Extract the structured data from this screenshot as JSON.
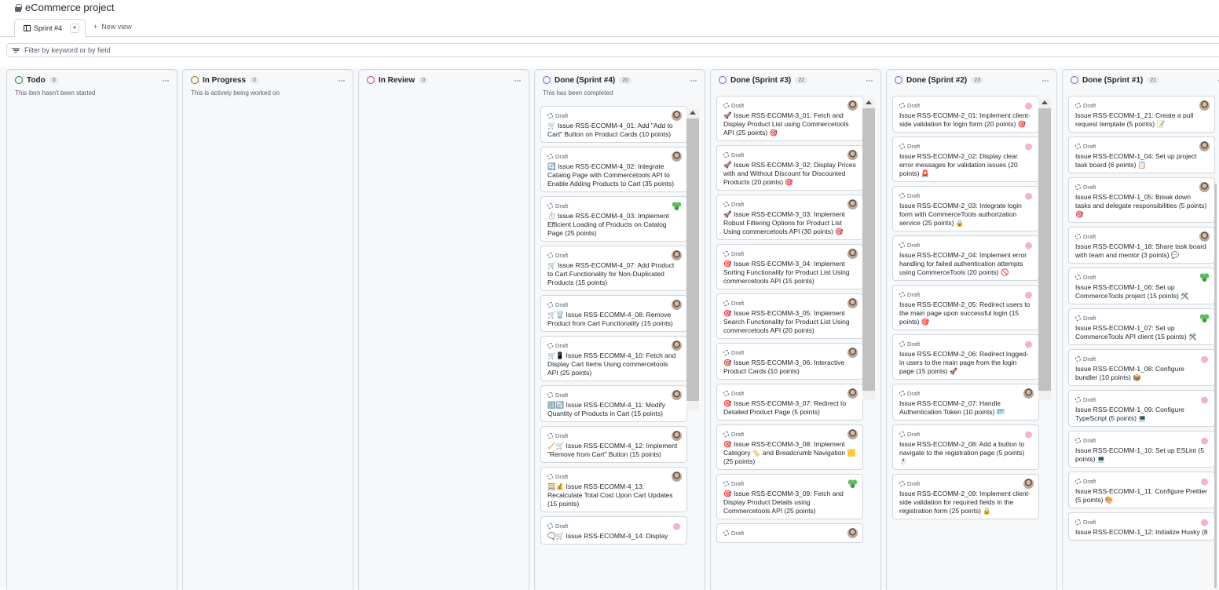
{
  "project": {
    "title": "eCommerce project"
  },
  "tabs": [
    {
      "label": "Sprint #4"
    }
  ],
  "new_view_label": "New view",
  "filter": {
    "placeholder": "Filter by keyword or by field"
  },
  "colors": {
    "todo": "#1a7f37",
    "in_progress": "#9a6700",
    "in_review": "#bf3989",
    "done": "#8250df",
    "border": "#d0d7de"
  },
  "columns": [
    {
      "name": "Todo",
      "count": "0",
      "description": "This item hasn't been started",
      "status": "todo",
      "cards": []
    },
    {
      "name": "In Progress",
      "count": "0",
      "description": "This is actively being worked on",
      "status": "in_progress",
      "cards": []
    },
    {
      "name": "In Review",
      "count": "0",
      "description": "",
      "status": "in_review",
      "cards": []
    },
    {
      "name": "Done (Sprint #4)",
      "count": "20",
      "description": "This has been completed",
      "status": "done",
      "cards": [
        {
          "status": "Draft",
          "avatar": "photo",
          "title": "🛒 Issue RSS-ECOMM-4_01: Add \"Add to Cart\" Button on Product Cards (10 points)"
        },
        {
          "status": "Draft",
          "avatar": "photo",
          "title": "🔄 Issue RSS-ECOMM-4_02: Integrate Catalog Page with Commercetools API to Enable Adding Products to Cart (35 points)"
        },
        {
          "status": "Draft",
          "avatar": "clover",
          "title": "⏱️ Issue RSS-ECOMM-4_03: Implement Efficient Loading of Products on Catalog Page (25 points)"
        },
        {
          "status": "Draft",
          "avatar": "photo",
          "title": "🛒 Issue RSS-ECOMM-4_07: Add Product to Cart Functionality for Non-Duplicated Products (15 points)"
        },
        {
          "status": "Draft",
          "avatar": "photo",
          "title": "🛒🗑️ Issue RSS-ECOMM-4_08: Remove Product from Cart Functionality (15 points)"
        },
        {
          "status": "Draft",
          "avatar": "photo",
          "title": "🛒📱 Issue RSS-ECOMM-4_10: Fetch and Display Cart Items Using commercetools API (25 points)"
        },
        {
          "status": "Draft",
          "avatar": "photo",
          "title": "🔢🔄 Issue RSS-ECOMM-4_11: Modify Quantity of Products in Cart (15 points)"
        },
        {
          "status": "Draft",
          "avatar": "photo",
          "title": "🧹🛒 Issue RSS-ECOMM-4_12: Implement \"Remove from Cart\" Button (15 points)"
        },
        {
          "status": "Draft",
          "avatar": "photo",
          "title": "🧮💰 Issue RSS-ECOMM-4_13: Recalculate Total Cost Upon Cart Updates (15 points)"
        },
        {
          "status": "Draft",
          "avatar": "pig",
          "title": "🗨️🛒 Issue RSS-ECOMM-4_14: Display"
        }
      ]
    },
    {
      "name": "Done (Sprint #3)",
      "count": "22",
      "description": "",
      "status": "done",
      "cards": [
        {
          "status": "Draft",
          "avatar": "photo",
          "title": "🚀 Issue RSS-ECOMM-3_01: Fetch and Display Product List using Commercetools API (25 points) 🎯"
        },
        {
          "status": "Draft",
          "avatar": "photo",
          "title": "🚀 Issue RSS-ECOMM-3_02: Display Prices with and Without Discount for Discounted Products (20 points) 🎯"
        },
        {
          "status": "Draft",
          "avatar": "photo",
          "title": "🚀 Issue RSS-ECOMM-3_03: Implement Robust Filtering Options for Product List Using commercetools API (30 points) 🎯"
        },
        {
          "status": "Draft",
          "avatar": "photo",
          "title": "🎯 Issue RSS-ECOMM-3_04: Implement Sorting Functionality for Product List Using commercetools API (15 points)"
        },
        {
          "status": "Draft",
          "avatar": "photo",
          "title": "🎯 Issue RSS-ECOMM-3_05: Implement Search Functionality for Product List Using commercetools API (20 points)"
        },
        {
          "status": "Draft",
          "avatar": "photo",
          "title": "🎯 Issue RSS-ECOMM-3_06: Interactive Product Cards (10 points)"
        },
        {
          "status": "Draft",
          "avatar": "photo",
          "title": "🎯 Issue RSS-ECOMM-3_07: Redirect to Detailed Product Page (5 points)"
        },
        {
          "status": "Draft",
          "avatar": "photo",
          "title": "🎯 Issue RSS-ECOMM-3_08: Implement Category 🏷️ and Breadcrumb Navigation 🟨 (25 points)"
        },
        {
          "status": "Draft",
          "avatar": "clover",
          "title": "🎯 Issue RSS-ECOMM-3_09: Fetch and Display Product Details using Commercetools API (25 points)"
        },
        {
          "status": "Draft",
          "avatar": "photo",
          "title": ""
        }
      ]
    },
    {
      "name": "Done (Sprint #2)",
      "count": "23",
      "description": "",
      "status": "done",
      "cards": [
        {
          "status": "Draft",
          "avatar": "pig",
          "title": "Issue RSS-ECOMM-2_01: Implement client-side validation for login form (20 points) 🎯"
        },
        {
          "status": "Draft",
          "avatar": "pig",
          "title": "Issue RSS-ECOMM-2_02: Display clear error messages for validation issues (20 points) 🚨"
        },
        {
          "status": "Draft",
          "avatar": "pig",
          "title": "Issue RSS-ECOMM-2_03: Integrate login form with CommerceTools authorization service (25 points) 🔒"
        },
        {
          "status": "Draft",
          "avatar": "pig",
          "title": "Issue RSS-ECOMM-2_04: Implement error handling for failed authentication attempts using CommerceTools (20 points) 🚫"
        },
        {
          "status": "Draft",
          "avatar": "pig",
          "title": "Issue RSS-ECOMM-2_05: Redirect users to the main page upon successful login (15 points) 🎯"
        },
        {
          "status": "Draft",
          "avatar": "pig",
          "title": "Issue RSS-ECOMM-2_06: Redirect logged-in users to the main page from the login page (15 points) 🚀"
        },
        {
          "status": "Draft",
          "avatar": "photo",
          "title": "Issue RSS-ECOMM-2_07: Handle Authentication Token (10 points) 🪪"
        },
        {
          "status": "Draft",
          "avatar": "pig",
          "title": "Issue RSS-ECOMM-2_08: Add a button to navigate to the registration page (5 points) 🖱️"
        },
        {
          "status": "Draft",
          "avatar": "photo",
          "title": "Issue RSS-ECOMM-2_09: Implement client-side validation for required fields in the registration form (25 points) 🔒"
        }
      ]
    },
    {
      "name": "Done (Sprint #1)",
      "count": "21",
      "description": "",
      "status": "done",
      "cards": [
        {
          "status": "Draft",
          "avatar": "photo",
          "title": "Issue RSS-ECOMM-1_21: Create a pull request template (5 points) 📝"
        },
        {
          "status": "Draft",
          "avatar": "photo",
          "title": "Issue RSS-ECOMM-1_04: Set up project task board (6 points) 📋"
        },
        {
          "status": "Draft",
          "avatar": "photo",
          "title": "Issue RSS-ECOMM-1_05: Break down tasks and delegate responsibilities (5 points) 🎯"
        },
        {
          "status": "Draft",
          "avatar": "photo",
          "title": "Issue RSS-ECOMM-1_18: Share task board with team and mentor (3 points) 💬"
        },
        {
          "status": "Draft",
          "avatar": "clover",
          "title": "Issue RSS-ECOMM-1_06: Set up CommerceTools project (15 points) 🛠️"
        },
        {
          "status": "Draft",
          "avatar": "clover",
          "title": "Issue RSS-ECOMM-1_07: Set up CommerceTools API client (15 points) 🛠️"
        },
        {
          "status": "Draft",
          "avatar": "pig",
          "title": "Issue RSS-ECOMM-1_08: Configure bundler (10 points) 📦"
        },
        {
          "status": "Draft",
          "avatar": "pig",
          "title": "Issue RSS-ECOMM-1_09: Configure TypeScript (5 points) 💻"
        },
        {
          "status": "Draft",
          "avatar": "pig",
          "title": "Issue RSS-ECOMM-1_10: Set up ESLint (5 points) 💻"
        },
        {
          "status": "Draft",
          "avatar": "pig",
          "title": "Issue RSS-ECOMM-1_11: Configure Prettier (5 points) 🎨"
        },
        {
          "status": "Draft",
          "avatar": "pig",
          "title": "Issue RSS-ECOMM-1_12: Initialize Husky (8"
        }
      ]
    }
  ]
}
